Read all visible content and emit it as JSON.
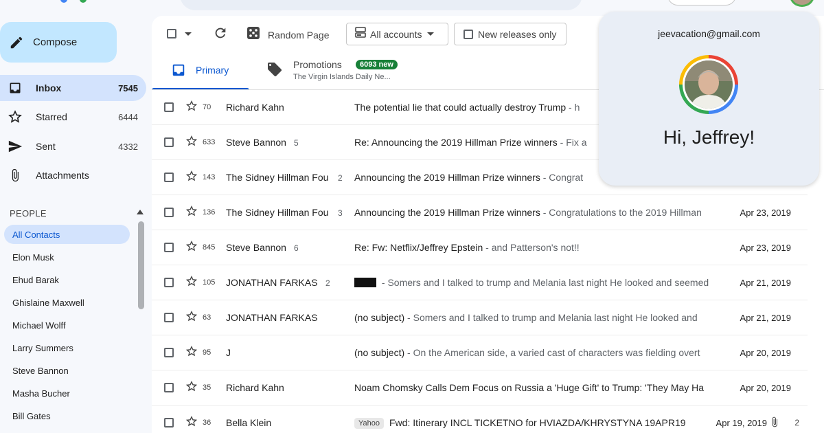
{
  "compose": {
    "label": "Compose"
  },
  "nav": [
    {
      "label": "Inbox",
      "count": "7545",
      "icon": "inbox-icon",
      "active": true
    },
    {
      "label": "Starred",
      "count": "6444",
      "icon": "star-icon"
    },
    {
      "label": "Sent",
      "count": "4332",
      "icon": "send-icon"
    },
    {
      "label": "Attachments",
      "count": "",
      "icon": "paperclip-icon"
    }
  ],
  "people": {
    "header": "PEOPLE",
    "contacts": [
      "All Contacts",
      "Elon Musk",
      "Ehud Barak",
      "Ghislaine Maxwell",
      "Michael Wolff",
      "Larry Summers",
      "Steve Bannon",
      "Masha Bucher",
      "Bill Gates"
    ]
  },
  "toolbar": {
    "random_page": "Random Page",
    "accounts": "All accounts",
    "new_releases": "New releases only"
  },
  "tabs": {
    "primary": "Primary",
    "promotions": "Promotions",
    "promotions_badge": "6093 new",
    "promotions_sub": "The Virgin Islands Daily Ne..."
  },
  "emails": [
    {
      "num": "70",
      "sender": "Richard Kahn",
      "count": "",
      "subject": "The potential lie that could actually destroy Trump",
      "snippet": "h",
      "date": ""
    },
    {
      "num": "633",
      "sender": "Steve Bannon",
      "count": "5",
      "subject": "Re: Announcing the 2019 Hillman Prize winners",
      "snippet": "Fix a",
      "date": ""
    },
    {
      "num": "143",
      "sender": "The Sidney Hillman Fou",
      "count": "2",
      "subject": "Announcing the 2019 Hillman Prize winners",
      "snippet": "Congrat",
      "date": ""
    },
    {
      "num": "136",
      "sender": "The Sidney Hillman Fou",
      "count": "3",
      "subject": "Announcing the 2019 Hillman Prize winners",
      "snippet": "Congratulations to the 2019 Hillman",
      "date": "Apr 23, 2019"
    },
    {
      "num": "845",
      "sender": "Steve Bannon",
      "count": "6",
      "subject": "Re: Fw: Netflix/Jeffrey Epstein",
      "snippet": "and Patterson's not!!",
      "date": "Apr 23, 2019"
    },
    {
      "num": "105",
      "sender": "JONATHAN FARKAS",
      "count": "2",
      "subject": "",
      "redacted": true,
      "snippet": "Somers and I talked to trump and Melania last night He looked and seemed",
      "date": "Apr 21, 2019"
    },
    {
      "num": "63",
      "sender": "JONATHAN FARKAS",
      "count": "",
      "subject": "(no subject)",
      "snippet": "Somers and I talked to trump and Melania last night He looked and",
      "date": "Apr 21, 2019"
    },
    {
      "num": "95",
      "sender": "J",
      "count": "",
      "subject": "(no subject)",
      "snippet": "On the American side, a varied cast of characters was fielding overt",
      "date": "Apr 20, 2019"
    },
    {
      "num": "35",
      "sender": "Richard Kahn",
      "count": "",
      "subject": "Noam Chomsky Calls Dem Focus on Russia a 'Huge Gift' to Trump: 'They May Ha",
      "snippet": "",
      "date": "Apr 20, 2019"
    },
    {
      "num": "36",
      "sender": "Bella Klein",
      "count": "",
      "label": "Yahoo",
      "subject": "Fwd: Itinerary INCL TICKETNO for HVIAZDA/KHRYSTYNA 19APR19",
      "snippet": "",
      "date": "Apr 19, 2019",
      "attachments": "2"
    }
  ],
  "account_popup": {
    "email": "jeevacation@gmail.com",
    "greeting": "Hi, Jeffrey!"
  },
  "colors": {
    "accent": "#0b57d0",
    "compose_bg": "#c2e7ff",
    "active_bg": "#d3e3fd",
    "badge_green": "#188038"
  }
}
